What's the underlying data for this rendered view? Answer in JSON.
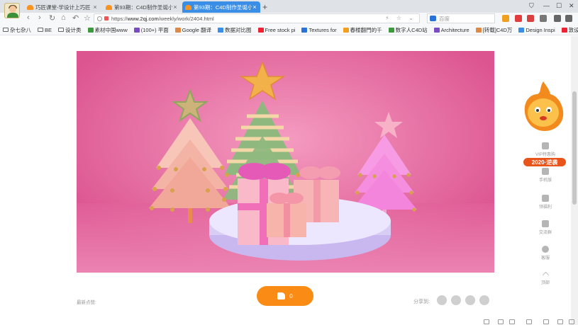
{
  "tabs": [
    {
      "label": "巧匠课堂-学设计上巧匠 优",
      "active": false
    },
    {
      "label": "第93期：C4D制作圣诞小",
      "active": false
    },
    {
      "label": "第93期：C4D制作圣诞小",
      "active": true
    }
  ],
  "tab_close_glyph": "×",
  "new_tab_glyph": "+",
  "window_controls": [
    "⛉",
    "—",
    "☐",
    "✕"
  ],
  "nav": {
    "back_glyph": "‹",
    "forward_glyph": "›",
    "reload_glyph": "↻",
    "home_glyph": "⌂",
    "undo_glyph": "↶",
    "star_glyph": "☆"
  },
  "url": {
    "prefix": "https://",
    "host": "www.2qj.com",
    "path": "/weekly/work/2404.html",
    "trailing": "⚡ ☆ ⌄"
  },
  "search_placeholder": "百度",
  "bookmarks": [
    {
      "label": "杂七杂八",
      "icon": "folder-icon"
    },
    {
      "label": "BE",
      "icon": "folder-icon"
    },
    {
      "label": "设计类",
      "icon": "folder-icon"
    },
    {
      "label": "素材中国www",
      "icon": "site-icon"
    },
    {
      "label": "(100+) 平面",
      "icon": "site-icon"
    },
    {
      "label": "Google 翻译",
      "icon": "google-icon"
    },
    {
      "label": "数据对比图",
      "icon": "site-icon"
    },
    {
      "label": "Free stock pi",
      "icon": "site-icon"
    },
    {
      "label": "Textures for",
      "icon": "site-icon"
    },
    {
      "label": "春楼翻門的千",
      "icon": "site-icon"
    },
    {
      "label": "数字人C4D站",
      "icon": "site-icon"
    },
    {
      "label": "Architecture",
      "icon": "site-icon"
    },
    {
      "label": "[转载]C4D万",
      "icon": "site-icon"
    },
    {
      "label": "Design Inspi",
      "icon": "site-icon"
    },
    {
      "label": "敦设计",
      "icon": "site-icon"
    }
  ],
  "sidebar": {
    "badge": "2020·逆袭",
    "items": [
      {
        "label": "VIP特惠购"
      },
      {
        "label": "手机版"
      },
      {
        "label": "领福利"
      },
      {
        "label": "交流群"
      },
      {
        "label": "客服"
      },
      {
        "label": "顶部"
      }
    ]
  },
  "footer": {
    "latest_likes": "最新点赞:",
    "like_count": "0",
    "share_label": "分享到:"
  },
  "colors": {
    "accent": "#fa8c16",
    "tab_active": "#3a8ee6",
    "hero_bg": "#e45f98"
  }
}
